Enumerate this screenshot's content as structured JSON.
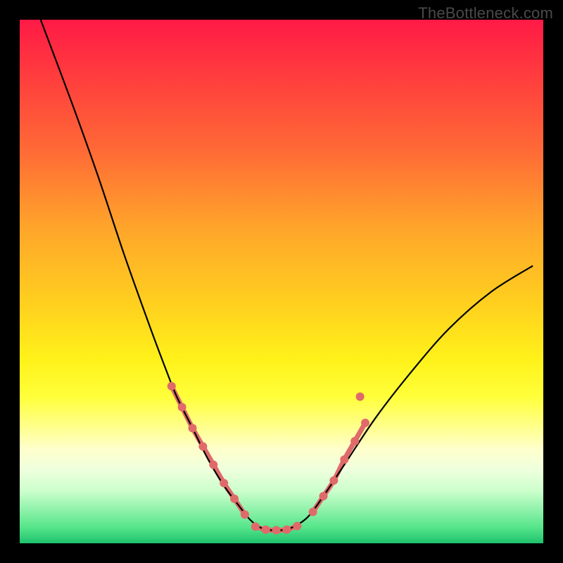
{
  "watermark": "TheBottleneck.com",
  "chart_data": {
    "type": "line",
    "title": "",
    "xlabel": "",
    "ylabel": "",
    "xlim": [
      0,
      100
    ],
    "ylim": [
      0,
      100
    ],
    "background_gradient": {
      "stops": [
        {
          "pos": 0,
          "color": "#ff1a46"
        },
        {
          "pos": 10,
          "color": "#ff3a3e"
        },
        {
          "pos": 25,
          "color": "#ff6a36"
        },
        {
          "pos": 40,
          "color": "#ffa62a"
        },
        {
          "pos": 55,
          "color": "#ffd21e"
        },
        {
          "pos": 65,
          "color": "#fff21a"
        },
        {
          "pos": 72,
          "color": "#ffff3a"
        },
        {
          "pos": 78,
          "color": "#ffff90"
        },
        {
          "pos": 82,
          "color": "#ffffcc"
        },
        {
          "pos": 86,
          "color": "#eeffdd"
        },
        {
          "pos": 90,
          "color": "#ccffcc"
        },
        {
          "pos": 97,
          "color": "#55e58a"
        },
        {
          "pos": 100,
          "color": "#1ec26e"
        }
      ]
    },
    "series": [
      {
        "name": "bottleneck-curve",
        "color": "#000000",
        "x": [
          4,
          10,
          15,
          20,
          25,
          28,
          30,
          33,
          36,
          39,
          42,
          44,
          46,
          48,
          50,
          52,
          55,
          58,
          62,
          68,
          75,
          82,
          90,
          98
        ],
        "y": [
          100,
          84,
          70,
          55,
          41,
          33,
          28,
          22,
          16,
          11,
          7,
          4.5,
          3,
          2.5,
          2.5,
          3,
          5,
          9,
          15,
          24,
          33,
          41,
          48,
          53
        ]
      }
    ],
    "highlight_segments": [
      {
        "name": "left-highlight",
        "color": "#e06a6a",
        "thickness": 7,
        "x": [
          29,
          31,
          33,
          35,
          37,
          39,
          41,
          43
        ],
        "y": [
          30,
          26,
          22,
          18.5,
          15,
          11.5,
          8.5,
          5.5
        ]
      },
      {
        "name": "bottom-highlight",
        "color": "#e06a6a",
        "thickness": 7,
        "x": [
          45,
          47,
          49,
          51,
          53
        ],
        "y": [
          3.2,
          2.6,
          2.5,
          2.6,
          3.3
        ]
      },
      {
        "name": "right-highlight",
        "color": "#e06a6a",
        "thickness": 7,
        "x": [
          56,
          58,
          60,
          62,
          64,
          66
        ],
        "y": [
          6,
          9,
          12,
          16,
          19.5,
          23
        ]
      }
    ],
    "markers": [
      {
        "x": 29,
        "y": 30,
        "r": 6,
        "color": "#e06a6a"
      },
      {
        "x": 31,
        "y": 26,
        "r": 6,
        "color": "#e06a6a"
      },
      {
        "x": 33,
        "y": 22,
        "r": 6,
        "color": "#e06a6a"
      },
      {
        "x": 35,
        "y": 18.5,
        "r": 6,
        "color": "#e06a6a"
      },
      {
        "x": 37,
        "y": 15,
        "r": 6,
        "color": "#e06a6a"
      },
      {
        "x": 39,
        "y": 11.5,
        "r": 6,
        "color": "#e06a6a"
      },
      {
        "x": 41,
        "y": 8.5,
        "r": 6,
        "color": "#e06a6a"
      },
      {
        "x": 43,
        "y": 5.5,
        "r": 6,
        "color": "#e06a6a"
      },
      {
        "x": 45,
        "y": 3.2,
        "r": 6,
        "color": "#e06a6a"
      },
      {
        "x": 47,
        "y": 2.6,
        "r": 6,
        "color": "#e06a6a"
      },
      {
        "x": 49,
        "y": 2.5,
        "r": 6,
        "color": "#e06a6a"
      },
      {
        "x": 51,
        "y": 2.6,
        "r": 6,
        "color": "#e06a6a"
      },
      {
        "x": 53,
        "y": 3.3,
        "r": 6,
        "color": "#e06a6a"
      },
      {
        "x": 56,
        "y": 6,
        "r": 6,
        "color": "#e06a6a"
      },
      {
        "x": 58,
        "y": 9,
        "r": 6,
        "color": "#e06a6a"
      },
      {
        "x": 60,
        "y": 12,
        "r": 6,
        "color": "#e06a6a"
      },
      {
        "x": 62,
        "y": 16,
        "r": 6,
        "color": "#e06a6a"
      },
      {
        "x": 64,
        "y": 19.5,
        "r": 6,
        "color": "#e06a6a"
      },
      {
        "x": 65,
        "y": 28,
        "r": 6,
        "color": "#e06a6a"
      },
      {
        "x": 66,
        "y": 23,
        "r": 6,
        "color": "#e06a6a"
      }
    ]
  }
}
